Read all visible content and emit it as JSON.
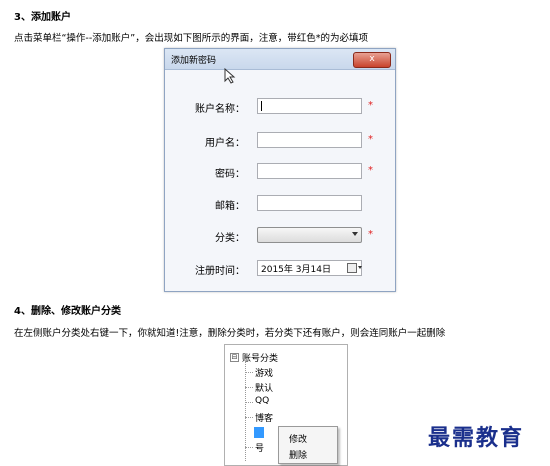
{
  "section3": {
    "heading": "3、添加账户",
    "text": "点击菜单栏“操作--添加账户”，会出现如下图所示的界面，注意，带红色*的为必填项"
  },
  "dialog": {
    "title": "添加新密码",
    "close": "x",
    "fields": {
      "account_label": "账户名称：",
      "user_label": "用户名：",
      "password_label": "密码：",
      "email_label": "邮箱：",
      "category_label": "分类：",
      "regtime_label": "注册时间：",
      "regtime_value": "2015年  3月14日",
      "required_mark": "*"
    }
  },
  "section4": {
    "heading": "4、删除、修改账户分类",
    "text": "在左侧账户分类处右键一下，你就知道!注意，删除分类时，若分类下还有账户，则会连同账户一起删除"
  },
  "tree": {
    "expander": "⊟",
    "root": "账号分类",
    "items": [
      "游戏",
      "默认",
      "QQ",
      "博客"
    ],
    "partial": "号"
  },
  "context_menu": {
    "edit": "修改",
    "delete": "删除"
  },
  "watermark": "最需教育",
  "colors": {
    "required": "#e02020",
    "watermark": "#1a2f8c",
    "selection": "#3399ff"
  }
}
